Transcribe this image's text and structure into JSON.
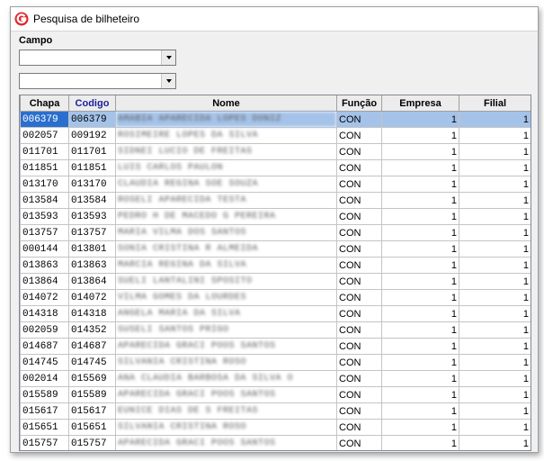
{
  "window": {
    "title": "Pesquisa de bilheteiro",
    "icon": "g-logo-icon",
    "accent_color": "#e0282e"
  },
  "filter": {
    "campo_label": "Campo",
    "combo1_value": "",
    "combo2_value": ""
  },
  "table": {
    "columns": [
      "Chapa",
      "Codigo",
      "Nome",
      "Função",
      "Empresa",
      "Filial"
    ],
    "sorted_column": "Codigo",
    "selected_row": 0,
    "rows": [
      [
        "006379",
        "006379",
        "AMABIA APARECIDA LOPES DONIZ",
        "CON",
        "1",
        "1"
      ],
      [
        "002057",
        "009192",
        "ROSIMEIRE LOPES DA SILVA",
        "CON",
        "1",
        "1"
      ],
      [
        "011701",
        "011701",
        "SIDNEI LUCIO DE FREITAS",
        "CON",
        "1",
        "1"
      ],
      [
        "011851",
        "011851",
        "LUIS CARLOS PAULON",
        "CON",
        "1",
        "1"
      ],
      [
        "013170",
        "013170",
        "CLAUDIA REGINA SOE SOUZA",
        "CON",
        "1",
        "1"
      ],
      [
        "013584",
        "013584",
        "ROSELI APARECIDA TESTA",
        "CON",
        "1",
        "1"
      ],
      [
        "013593",
        "013593",
        "PEDRO H DE MACEDO G PEREIRA",
        "CON",
        "1",
        "1"
      ],
      [
        "013757",
        "013757",
        "MARIA VILMA DOS SANTOS",
        "CON",
        "1",
        "1"
      ],
      [
        "000144",
        "013801",
        "SONIA CRISTINA R ALMEIDA",
        "CON",
        "1",
        "1"
      ],
      [
        "013863",
        "013863",
        "MARCIA REGINA DA SILVA",
        "CON",
        "1",
        "1"
      ],
      [
        "013864",
        "013864",
        "SUELI LANTALINI SPOSITO",
        "CON",
        "1",
        "1"
      ],
      [
        "014072",
        "014072",
        "VILMA GOMES DA LOURDES",
        "CON",
        "1",
        "1"
      ],
      [
        "014318",
        "014318",
        "ANGELA MARIA DA SILVA",
        "CON",
        "1",
        "1"
      ],
      [
        "002059",
        "014352",
        "SUSELI SANTOS PRIGO",
        "CON",
        "1",
        "1"
      ],
      [
        "014687",
        "014687",
        "APARECIDA GRACI POOS SANTOS",
        "CON",
        "1",
        "1"
      ],
      [
        "014745",
        "014745",
        "SILVANIA CRISTINA ROSO",
        "CON",
        "1",
        "1"
      ],
      [
        "002014",
        "015569",
        "ANA CLAUDIA BARBOSA DA SILVA O",
        "CON",
        "1",
        "1"
      ],
      [
        "015589",
        "015589",
        "APARECIDA GRACI POOS SANTOS",
        "CON",
        "1",
        "1"
      ],
      [
        "015617",
        "015617",
        "EUNICE DIAS DE S FREITAS",
        "CON",
        "1",
        "1"
      ],
      [
        "015651",
        "015651",
        "SILVANIA CRISTINA ROSO",
        "CON",
        "1",
        "1"
      ],
      [
        "015757",
        "015757",
        "APARECIDA GRACI POOS SANTOS",
        "CON",
        "1",
        "1"
      ]
    ]
  }
}
